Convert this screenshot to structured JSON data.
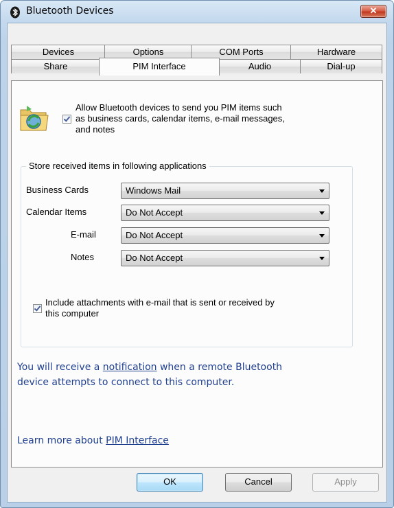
{
  "window": {
    "title": "Bluetooth Devices",
    "close_label": "✕"
  },
  "tabs": {
    "row1": [
      "Devices",
      "Options",
      "COM Ports",
      "Hardware"
    ],
    "row2": [
      "Share",
      "PIM Interface",
      "Audio",
      "Dial-up"
    ],
    "active": "PIM Interface"
  },
  "pim": {
    "allow_checkbox_label": "Allow Bluetooth devices to send you PIM items such as business cards, calendar items, e-mail messages, and notes",
    "allow_line1": "Allow Bluetooth devices to send you PIM items such",
    "allow_line2": "as business cards, calendar items, e-mail messages,",
    "allow_line3": "and notes",
    "allow_checked": true,
    "group_title": "Store received items in following applications",
    "fields": [
      {
        "label": "Business Cards",
        "value": "Windows Mail"
      },
      {
        "label": "Calendar Items",
        "value": "Do Not Accept"
      },
      {
        "label": "E-mail",
        "value": "Do Not Accept"
      },
      {
        "label": "Notes",
        "value": "Do Not Accept"
      }
    ],
    "attach_line1": "Include attachments with e-mail that is sent or received by",
    "attach_line2": "this computer",
    "attach_checked": true
  },
  "info": {
    "notify_pre": "You will receive a ",
    "notify_link": "notification",
    "notify_post": " when a remote Bluetooth",
    "notify_line2": "device attempts to connect to this computer.",
    "learn_pre": "Learn more about ",
    "learn_link": "PIM Interface"
  },
  "buttons": {
    "ok": "OK",
    "cancel": "Cancel",
    "apply": "Apply"
  },
  "icons": [
    "bluetooth-icon",
    "close-icon",
    "pim-folder-icon",
    "dropdown-arrow-icon"
  ]
}
